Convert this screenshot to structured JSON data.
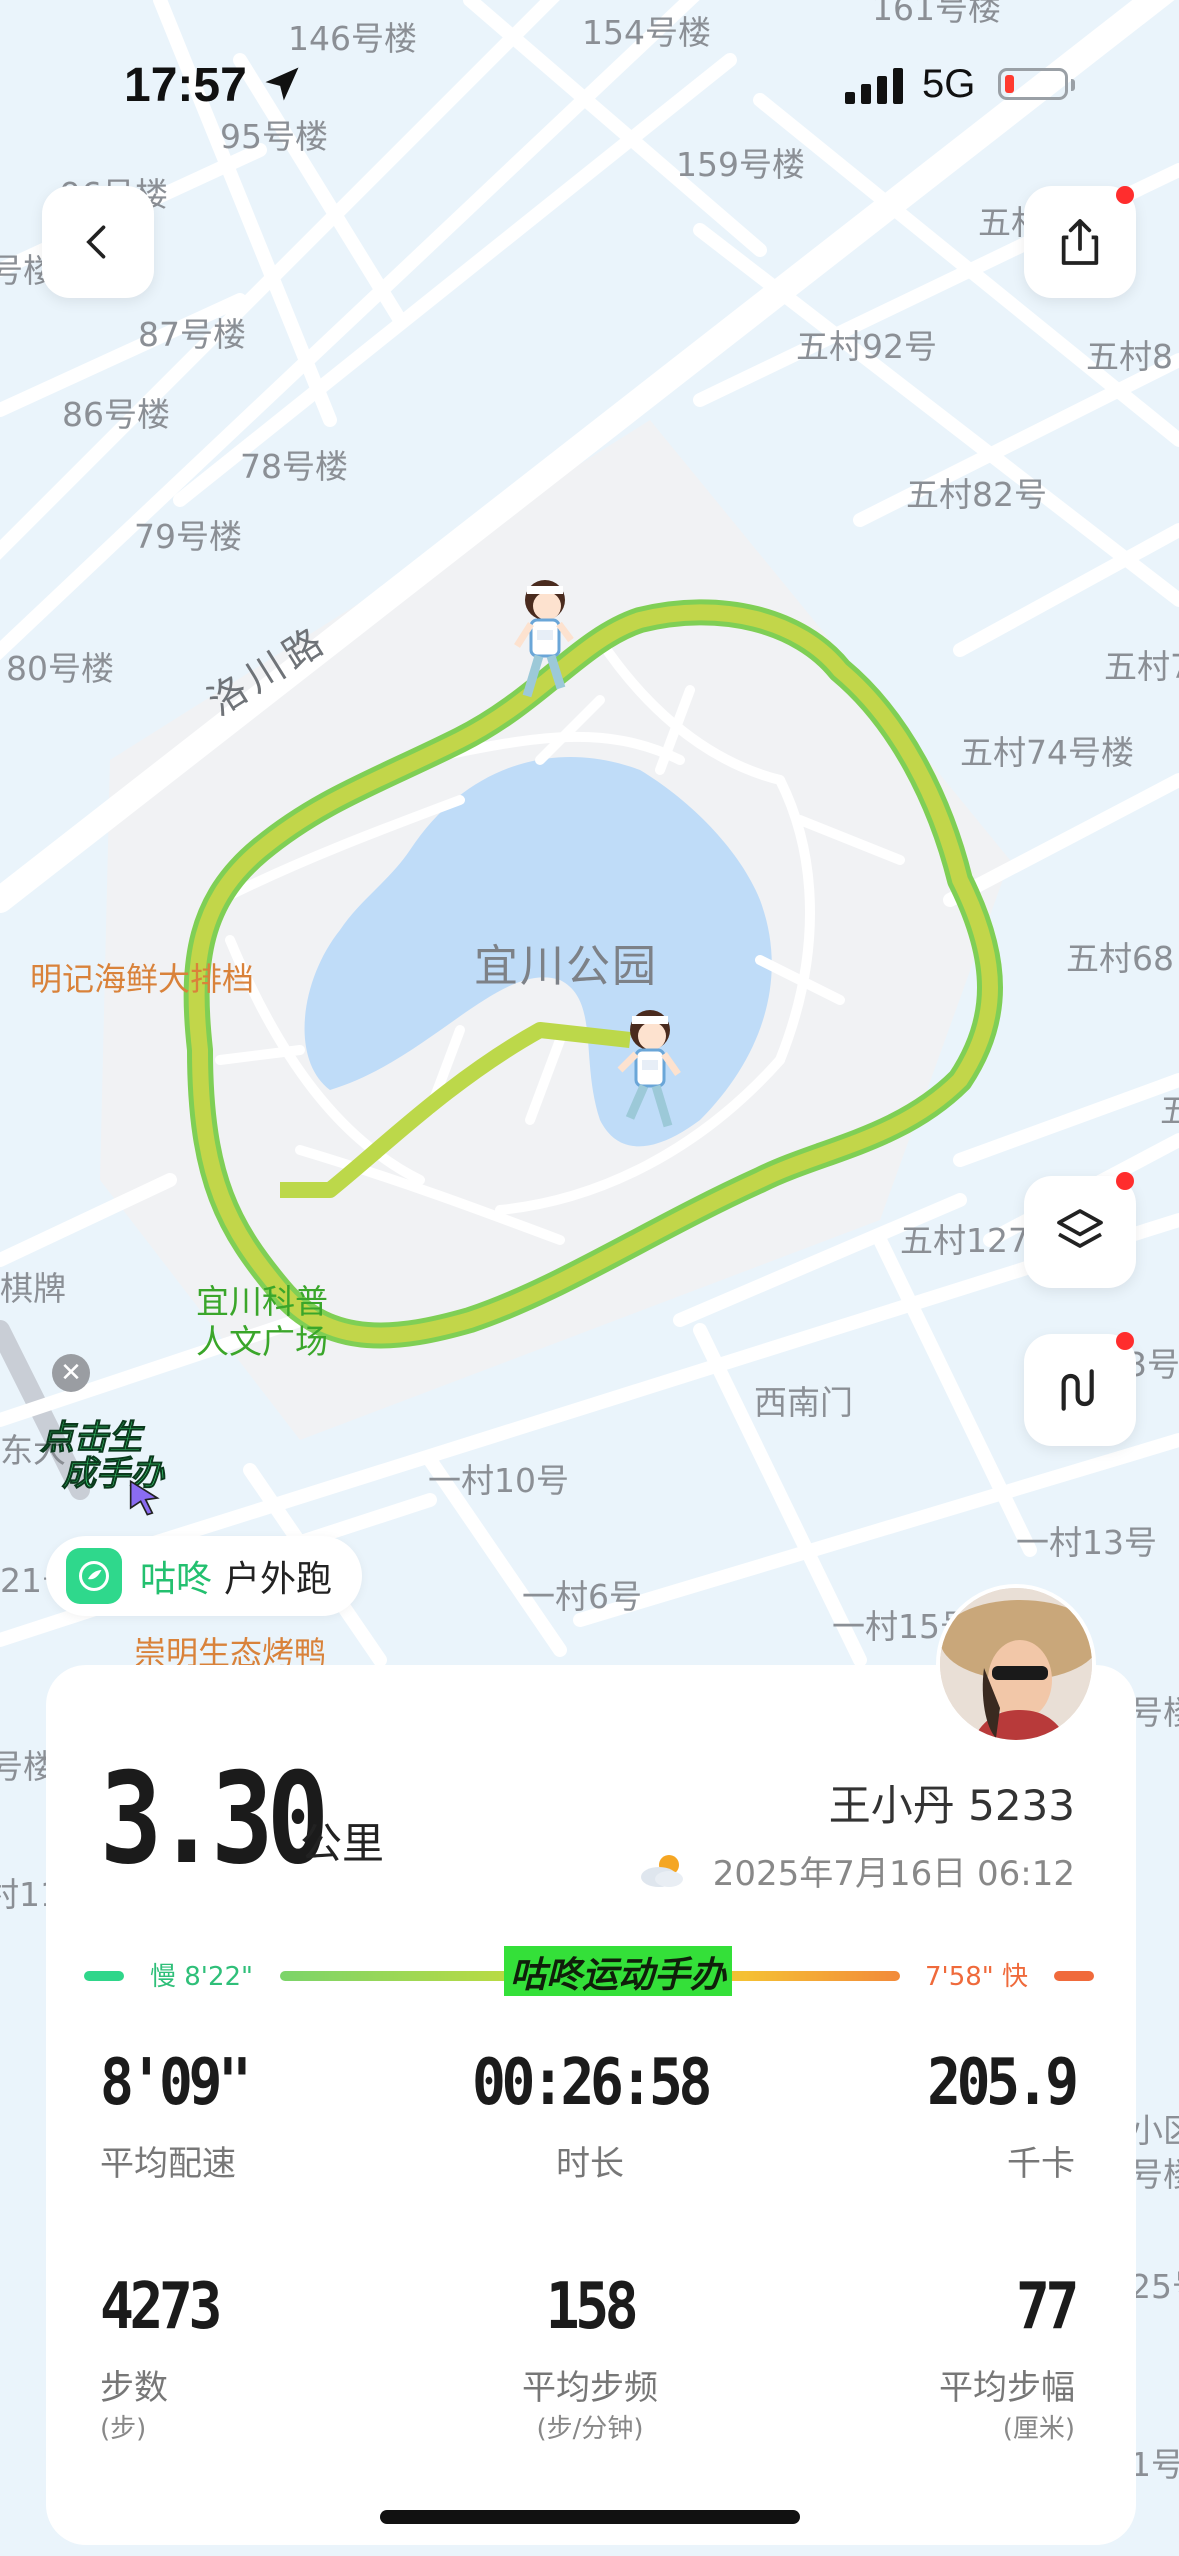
{
  "status_bar": {
    "time": "17:57",
    "network": "5G"
  },
  "map": {
    "labels": [
      "146号楼",
      "154号楼",
      "161号楼",
      "95号楼",
      "159号楼",
      "96号楼",
      "号楼",
      "87号楼",
      "五村92号",
      "五村8",
      "五村",
      "86号楼",
      "78号楼",
      "五村82号",
      "79号楼",
      "五村7",
      "80号楼",
      "五村74号楼",
      "五村68",
      "五",
      "五村127",
      "棋牌",
      "东大",
      "3号",
      "西南门",
      "一村10号",
      "21号",
      "一村13号",
      "一村6号",
      "一村15号",
      "号楼",
      "号楼",
      "村11",
      "小区",
      "号楼",
      "25号",
      "1号"
    ],
    "road_name": "洛川路",
    "park_name": "宜川公园",
    "poi": [
      "明记海鲜大排档",
      "崇明生态烤鸭"
    ],
    "green_poi": [
      "宜川科普",
      "人文广场"
    ]
  },
  "promo": {
    "line1": "点击生",
    "line2": "成手办"
  },
  "brand": {
    "name": "咕咚",
    "activity_type": "户外跑"
  },
  "summary": {
    "distance": "3.30",
    "distance_unit": "公里",
    "user_name": "王小丹 5233",
    "datetime": "2025年7月16日 06:12"
  },
  "pace_bar": {
    "slow_label": "慢 8'22\"",
    "fast_label": "7'58\" 快",
    "badge": "咕咚运动手办"
  },
  "metrics": [
    {
      "value": "8'09\"",
      "label": "平均配速",
      "sub": ""
    },
    {
      "value": "00:26:58",
      "label": "时长",
      "sub": ""
    },
    {
      "value": "205.9",
      "label": "千卡",
      "sub": ""
    },
    {
      "value": "4273",
      "label": "步数",
      "sub": "(步)"
    },
    {
      "value": "158",
      "label": "平均步频",
      "sub": "(步/分钟)"
    },
    {
      "value": "77",
      "label": "平均步幅",
      "sub": "(厘米)"
    }
  ],
  "colors": {
    "brand_green": "#2fd88c",
    "route": "#b9d64a",
    "slow": "#2fbf79",
    "fast": "#ef6a3b"
  }
}
